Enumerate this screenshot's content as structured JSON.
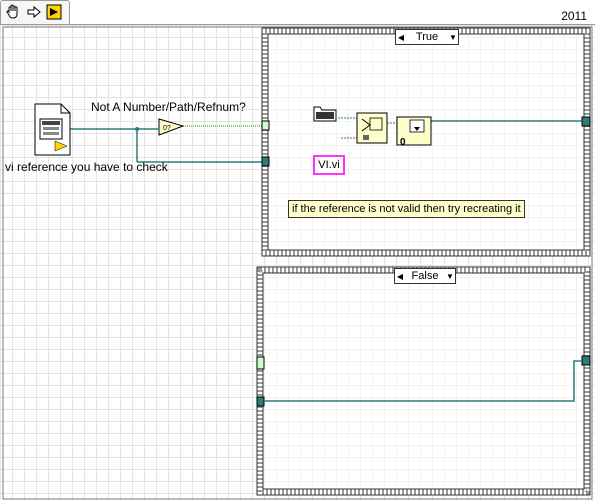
{
  "window": {
    "year": "2011",
    "toolbar": [
      {
        "icon": "hand-icon",
        "label": ""
      },
      {
        "icon": "arrow-right-icon",
        "label": ""
      },
      {
        "icon": "run-icon",
        "label": ""
      }
    ]
  },
  "diagram": {
    "control_label": "vi reference you have to check",
    "function_label": "Not A Number/Path/Refnum?",
    "case_true_selector": "True",
    "case_false_selector": "False",
    "vi_path_constant": "VI.vi",
    "comment": "if the reference is not valid then try recreating it",
    "zero_constant": "0"
  },
  "colors": {
    "wire_refnum": "#2d7d7d",
    "wire_boolean": "#00a000",
    "wire_path": "#2d7d7d",
    "case_border": "#555555",
    "comment_bg": "#ffffcc",
    "constant_border": "#ff33ff"
  }
}
